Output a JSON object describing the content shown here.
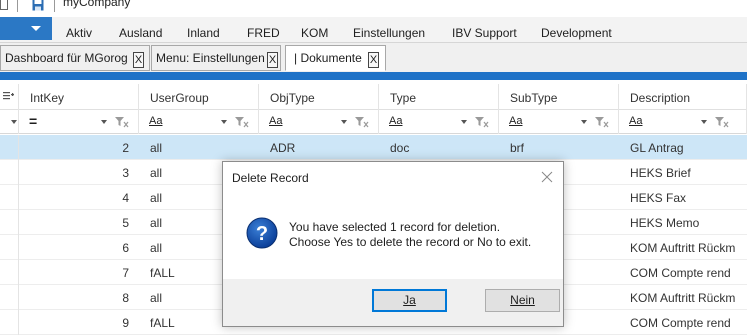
{
  "app": {
    "title": "myCompany"
  },
  "ribbon": {
    "tabs": [
      "Aktiv",
      "Ausland",
      "Inland",
      "FRED",
      "KOM",
      "Einstellungen",
      "IBV Support",
      "Development"
    ]
  },
  "doc_tabs": [
    {
      "label": "Dashboard für MGorog",
      "close": "X"
    },
    {
      "label": "Menu: Einstellungen",
      "close": "X"
    },
    {
      "label": "| Dokumente",
      "close": "X"
    }
  ],
  "grid": {
    "columns": [
      "IntKey",
      "UserGroup",
      "ObjType",
      "Type",
      "SubType",
      "Description"
    ],
    "filter": {
      "intkey_operator": "=",
      "text_operator": "Aa"
    },
    "rows": [
      {
        "intkey": "2",
        "usergroup": "all",
        "objtype": "ADR",
        "type": "doc",
        "subtype": "brf",
        "description": "GL Antrag"
      },
      {
        "intkey": "3",
        "usergroup": "all",
        "objtype": "",
        "type": "",
        "subtype": "",
        "description": "HEKS Brief"
      },
      {
        "intkey": "4",
        "usergroup": "all",
        "objtype": "",
        "type": "",
        "subtype": "",
        "description": "HEKS Fax"
      },
      {
        "intkey": "5",
        "usergroup": "all",
        "objtype": "",
        "type": "",
        "subtype": "",
        "description": "HEKS Memo"
      },
      {
        "intkey": "6",
        "usergroup": "all",
        "objtype": "",
        "type": "",
        "subtype": "",
        "description": "KOM Auftritt Rückm"
      },
      {
        "intkey": "7",
        "usergroup": "fALL",
        "objtype": "",
        "type": "",
        "subtype": "",
        "description": "COM Compte rend"
      },
      {
        "intkey": "8",
        "usergroup": "all",
        "objtype": "",
        "type": "",
        "subtype": "",
        "description": "KOM Auftritt Rückm"
      },
      {
        "intkey": "9",
        "usergroup": "fALL",
        "objtype": "",
        "type": "",
        "subtype": "",
        "description": "COM Compte rend"
      }
    ]
  },
  "dialog": {
    "title": "Delete Record",
    "line1": "You have selected 1 record for deletion.",
    "line2": "Choose Yes to delete the record or No to exit.",
    "yes_label": "Ja",
    "no_label": "Nein"
  },
  "colors": {
    "accent": "#1f72c7",
    "file_button": "#2b78c5",
    "selection": "#cde6f7"
  }
}
